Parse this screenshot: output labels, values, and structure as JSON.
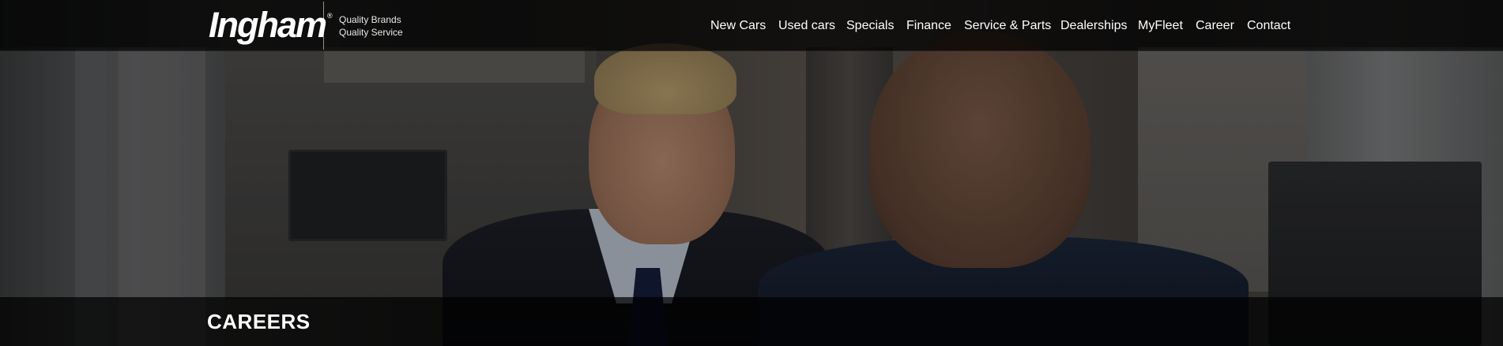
{
  "brand": {
    "logo_text": "Ingham",
    "registered_mark": "®",
    "tagline_line1": "Quality Brands",
    "tagline_line2": "Quality Service"
  },
  "nav": {
    "items": [
      {
        "label": "New Cars"
      },
      {
        "label": "Used cars"
      },
      {
        "label": "Specials"
      },
      {
        "label": "Finance"
      },
      {
        "label": "Service & Parts"
      },
      {
        "label": "Dealerships"
      },
      {
        "label": "MyFleet"
      },
      {
        "label": "Career"
      },
      {
        "label": "Contact"
      }
    ]
  },
  "hero": {
    "title": "CAREERS"
  },
  "colors": {
    "header_bg": "#000000",
    "text": "#ffffff"
  }
}
